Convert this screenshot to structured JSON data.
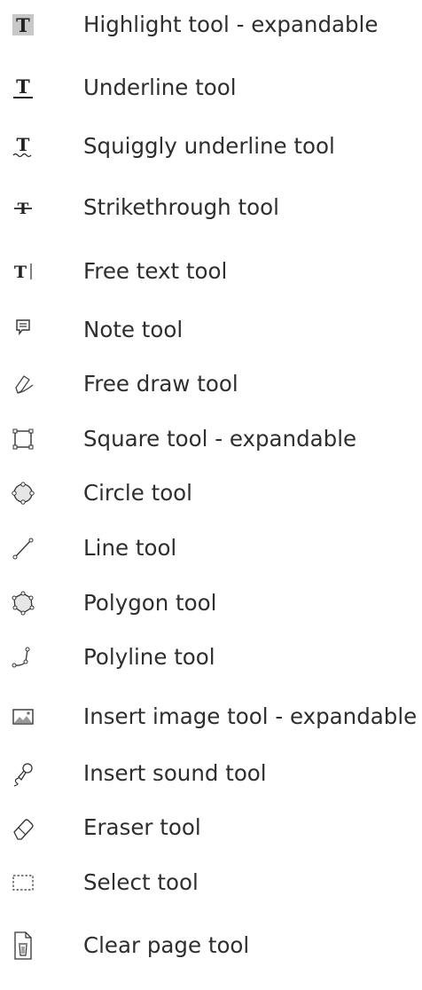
{
  "tools": [
    {
      "icon": "highlight-icon",
      "label": "Highlight tool - expandable"
    },
    {
      "icon": "underline-icon",
      "label": "Underline tool"
    },
    {
      "icon": "squiggly-underline-icon",
      "label": "Squiggly underline tool"
    },
    {
      "icon": "strikethrough-icon",
      "label": "Strikethrough tool"
    },
    {
      "icon": "free-text-icon",
      "label": "Free text tool"
    },
    {
      "icon": "note-icon",
      "label": "Note tool"
    },
    {
      "icon": "free-draw-icon",
      "label": "Free draw tool"
    },
    {
      "icon": "square-icon",
      "label": "Square tool - expandable"
    },
    {
      "icon": "circle-icon",
      "label": "Circle tool"
    },
    {
      "icon": "line-icon",
      "label": "Line tool"
    },
    {
      "icon": "polygon-icon",
      "label": "Polygon tool"
    },
    {
      "icon": "polyline-icon",
      "label": "Polyline tool"
    },
    {
      "icon": "insert-image-icon",
      "label": "Insert image tool - expandable"
    },
    {
      "icon": "insert-sound-icon",
      "label": "Insert sound tool"
    },
    {
      "icon": "eraser-icon",
      "label": "Eraser tool"
    },
    {
      "icon": "select-icon",
      "label": "Select tool"
    },
    {
      "icon": "clear-page-icon",
      "label": "Clear page tool"
    }
  ],
  "colors": {
    "text": "#2e2e2e",
    "icon": "#333333",
    "highlight_bg": "#c8c8c8"
  }
}
